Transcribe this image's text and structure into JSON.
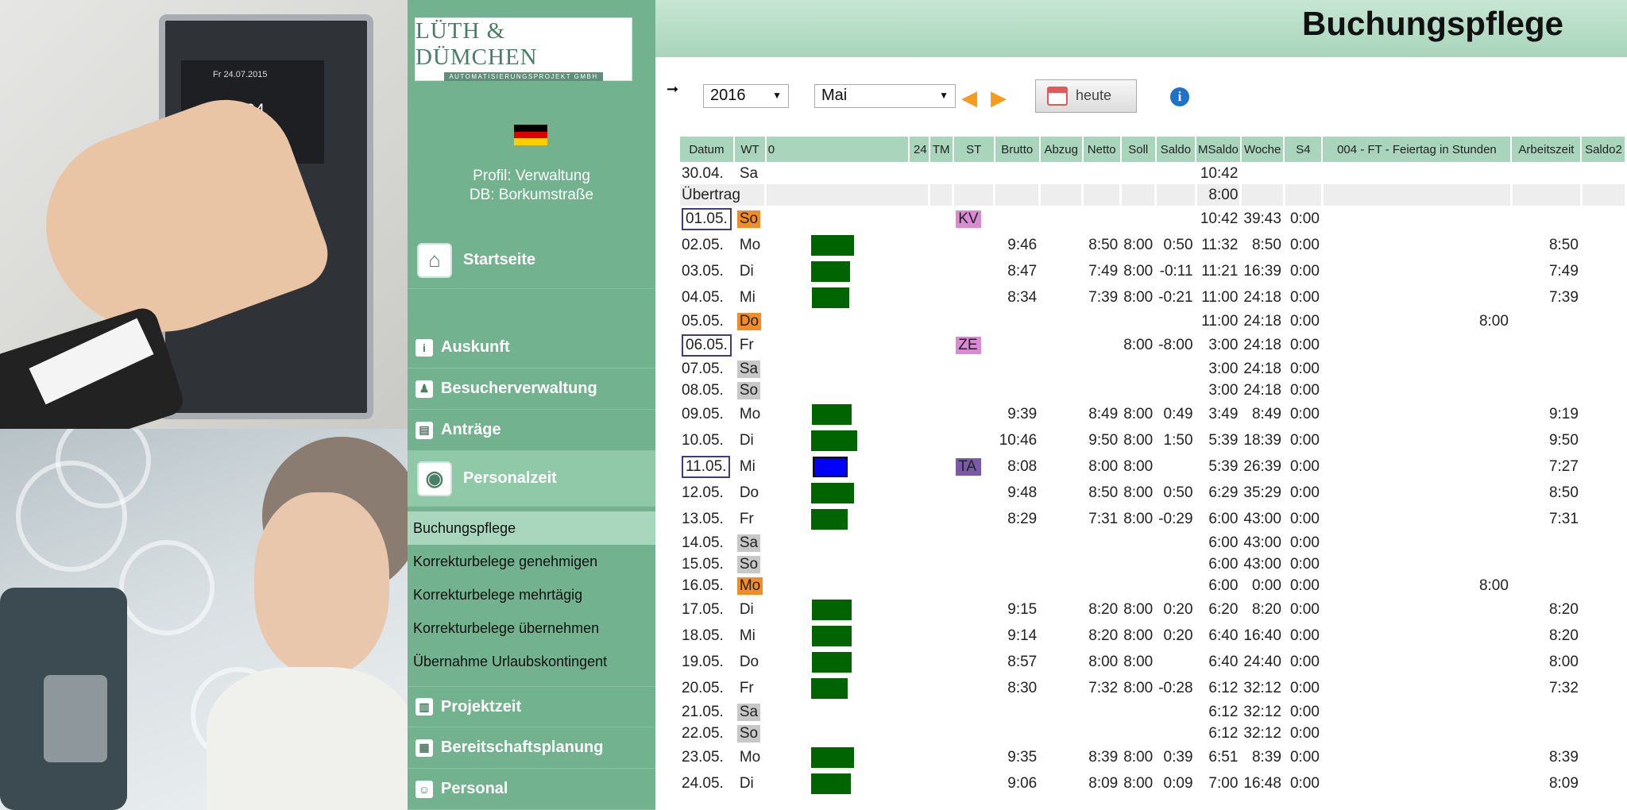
{
  "sidebar": {
    "logo_main": "LÜTH & DÜMCHEN",
    "logo_sub": "AUTOMATISIERUNGSPROJEKT GMBH",
    "profile_line1": "Profil: Verwaltung",
    "profile_line2": "DB: Borkumstraße",
    "startseite": "Startseite",
    "auskunft": "Auskunft",
    "besucherverwaltung": "Besucherverwaltung",
    "antraege": "Anträge",
    "personalzeit": "Personalzeit",
    "subitems": [
      "Buchungspflege",
      "Korrekturbelege genehmigen",
      "Korrekturbelege mehrtägig",
      "Korrekturbelege übernehmen",
      "Übernahme Urlaubskontingent"
    ],
    "projektzeit": "Projektzeit",
    "bereitschaftsplanung": "Bereitschaftsplanung",
    "personal": "Personal"
  },
  "terminal_screen": {
    "date": "Fr 24.07.2015",
    "time": "08:24"
  },
  "page": {
    "title": "Buchungspflege"
  },
  "toolbar": {
    "year": "2016",
    "month": "Mai",
    "today_label": "heute"
  },
  "table": {
    "headers": [
      "Datum",
      "WT",
      "0",
      "24",
      "TM",
      "ST",
      "Brutto",
      "Abzug",
      "Netto",
      "Soll",
      "Saldo",
      "MSaldo",
      "Woche",
      "S4",
      "004 - FT - Feiertag in Stunden",
      "Arbeitszeit",
      "Saldo2"
    ],
    "colors": {
      "green": "#006400",
      "blue": "#0000ff",
      "orange": "#f28c28",
      "gray": "#c8c8c8",
      "pink": "#d98ad3",
      "purple": "#7a5aa8"
    },
    "rows": [
      {
        "datum": "30.04.",
        "wt": "Sa",
        "wt_style": "none",
        "boxed": false,
        "st": "",
        "brutto": "",
        "netto": "",
        "soll": "",
        "saldo": "",
        "msaldo": "10:42",
        "woche": "",
        "s4": "",
        "ft": "",
        "arbeitszeit": "",
        "bar": null,
        "alt": false,
        "tall": false
      },
      {
        "datum": "Übertrag",
        "wt": "",
        "wt_style": "none",
        "boxed": false,
        "st": "",
        "brutto": "",
        "netto": "",
        "soll": "",
        "saldo": "",
        "msaldo": "8:00",
        "woche": "",
        "s4": "",
        "ft": "",
        "arbeitszeit": "",
        "bar": null,
        "alt": true,
        "tall": false
      },
      {
        "datum": "01.05.",
        "wt": "So",
        "wt_style": "orange",
        "boxed": true,
        "st": "KV",
        "st_color": "pink",
        "brutto": "",
        "netto": "",
        "soll": "",
        "saldo": "",
        "msaldo": "10:42",
        "woche": "39:43",
        "s4": "0:00",
        "ft": "",
        "arbeitszeit": "",
        "bar": null,
        "alt": false,
        "tall": true
      },
      {
        "datum": "02.05.",
        "wt": "Mo",
        "wt_style": "none",
        "boxed": false,
        "st": "",
        "brutto": "9:46",
        "netto": "8:50",
        "soll": "8:00",
        "saldo": "0:50",
        "msaldo": "11:32",
        "woche": "8:50",
        "s4": "0:00",
        "ft": "",
        "arbeitszeit": "8:50",
        "bar": {
          "start_hour": 6.4,
          "end_hour": 12.8,
          "color": "green"
        },
        "alt": false,
        "tall": true
      },
      {
        "datum": "03.05.",
        "wt": "Di",
        "wt_style": "none",
        "boxed": false,
        "st": "",
        "brutto": "8:47",
        "netto": "7:49",
        "soll": "8:00",
        "saldo": "-0:11",
        "msaldo": "11:21",
        "woche": "16:39",
        "s4": "0:00",
        "ft": "",
        "arbeitszeit": "7:49",
        "bar": {
          "start_hour": 6.4,
          "end_hour": 12.2,
          "color": "green"
        },
        "alt": false,
        "tall": true
      },
      {
        "datum": "04.05.",
        "wt": "Mi",
        "wt_style": "none",
        "boxed": false,
        "st": "",
        "brutto": "8:34",
        "netto": "7:39",
        "soll": "8:00",
        "saldo": "-0:21",
        "msaldo": "11:00",
        "woche": "24:18",
        "s4": "0:00",
        "ft": "",
        "arbeitszeit": "7:39",
        "bar": {
          "start_hour": 6.5,
          "end_hour": 12.1,
          "color": "green"
        },
        "alt": false,
        "tall": true
      },
      {
        "datum": "05.05.",
        "wt": "Do",
        "wt_style": "orange",
        "boxed": false,
        "st": "",
        "brutto": "",
        "netto": "",
        "soll": "",
        "saldo": "",
        "msaldo": "11:00",
        "woche": "24:18",
        "s4": "0:00",
        "ft": "8:00",
        "arbeitszeit": "",
        "bar": null,
        "alt": false,
        "tall": false
      },
      {
        "datum": "06.05.",
        "wt": "Fr",
        "wt_style": "none",
        "boxed": true,
        "st": "ZE",
        "st_color": "pink",
        "brutto": "",
        "netto": "",
        "soll": "8:00",
        "saldo": "-8:00",
        "msaldo": "3:00",
        "woche": "24:18",
        "s4": "0:00",
        "ft": "",
        "arbeitszeit": "",
        "bar": null,
        "alt": false,
        "tall": true
      },
      {
        "datum": "07.05.",
        "wt": "Sa",
        "wt_style": "gray",
        "boxed": false,
        "st": "",
        "brutto": "",
        "netto": "",
        "soll": "",
        "saldo": "",
        "msaldo": "3:00",
        "woche": "24:18",
        "s4": "0:00",
        "ft": "",
        "arbeitszeit": "",
        "bar": null,
        "alt": false,
        "tall": false
      },
      {
        "datum": "08.05.",
        "wt": "So",
        "wt_style": "gray",
        "boxed": false,
        "st": "",
        "brutto": "",
        "netto": "",
        "soll": "",
        "saldo": "",
        "msaldo": "3:00",
        "woche": "24:18",
        "s4": "0:00",
        "ft": "",
        "arbeitszeit": "",
        "bar": null,
        "alt": false,
        "tall": false
      },
      {
        "datum": "09.05.",
        "wt": "Mo",
        "wt_style": "none",
        "boxed": false,
        "st": "",
        "brutto": "9:39",
        "netto": "8:49",
        "soll": "8:00",
        "saldo": "0:49",
        "msaldo": "3:49",
        "woche": "8:49",
        "s4": "0:00",
        "ft": "",
        "arbeitszeit": "9:19",
        "bar": {
          "start_hour": 6.5,
          "end_hour": 12.4,
          "color": "green"
        },
        "alt": false,
        "tall": true
      },
      {
        "datum": "10.05.",
        "wt": "Di",
        "wt_style": "none",
        "boxed": false,
        "st": "",
        "brutto": "10:46",
        "netto": "9:50",
        "soll": "8:00",
        "saldo": "1:50",
        "msaldo": "5:39",
        "woche": "18:39",
        "s4": "0:00",
        "ft": "",
        "arbeitszeit": "9:50",
        "bar": {
          "start_hour": 6.4,
          "end_hour": 13.3,
          "color": "green"
        },
        "alt": false,
        "tall": true
      },
      {
        "datum": "11.05.",
        "wt": "Mi",
        "wt_style": "none",
        "boxed": true,
        "st": "TA",
        "st_color": "purple",
        "brutto": "8:08",
        "netto": "8:00",
        "soll": "8:00",
        "saldo": "",
        "msaldo": "5:39",
        "woche": "26:39",
        "s4": "0:00",
        "ft": "",
        "arbeitszeit": "7:27",
        "bar": {
          "start_hour": 6.6,
          "end_hour": 11.8,
          "color": "blue"
        },
        "alt": false,
        "tall": true
      },
      {
        "datum": "12.05.",
        "wt": "Do",
        "wt_style": "none",
        "boxed": false,
        "st": "",
        "brutto": "9:48",
        "netto": "8:50",
        "soll": "8:00",
        "saldo": "0:50",
        "msaldo": "6:29",
        "woche": "35:29",
        "s4": "0:00",
        "ft": "",
        "arbeitszeit": "8:50",
        "bar": {
          "start_hour": 6.4,
          "end_hour": 12.8,
          "color": "green"
        },
        "alt": false,
        "tall": true
      },
      {
        "datum": "13.05.",
        "wt": "Fr",
        "wt_style": "none",
        "boxed": false,
        "st": "",
        "brutto": "8:29",
        "netto": "7:31",
        "soll": "8:00",
        "saldo": "-0:29",
        "msaldo": "6:00",
        "woche": "43:00",
        "s4": "0:00",
        "ft": "",
        "arbeitszeit": "7:31",
        "bar": {
          "start_hour": 6.4,
          "end_hour": 11.9,
          "color": "green"
        },
        "alt": false,
        "tall": true
      },
      {
        "datum": "14.05.",
        "wt": "Sa",
        "wt_style": "gray",
        "boxed": false,
        "st": "",
        "brutto": "",
        "netto": "",
        "soll": "",
        "saldo": "",
        "msaldo": "6:00",
        "woche": "43:00",
        "s4": "0:00",
        "ft": "",
        "arbeitszeit": "",
        "bar": null,
        "alt": false,
        "tall": false
      },
      {
        "datum": "15.05.",
        "wt": "So",
        "wt_style": "gray",
        "boxed": false,
        "st": "",
        "brutto": "",
        "netto": "",
        "soll": "",
        "saldo": "",
        "msaldo": "6:00",
        "woche": "43:00",
        "s4": "0:00",
        "ft": "",
        "arbeitszeit": "",
        "bar": null,
        "alt": false,
        "tall": false
      },
      {
        "datum": "16.05.",
        "wt": "Mo",
        "wt_style": "orange",
        "boxed": false,
        "st": "",
        "brutto": "",
        "netto": "",
        "soll": "",
        "saldo": "",
        "msaldo": "6:00",
        "woche": "0:00",
        "s4": "0:00",
        "ft": "8:00",
        "arbeitszeit": "",
        "bar": null,
        "alt": false,
        "tall": false
      },
      {
        "datum": "17.05.",
        "wt": "Di",
        "wt_style": "none",
        "boxed": false,
        "st": "",
        "brutto": "9:15",
        "netto": "8:20",
        "soll": "8:00",
        "saldo": "0:20",
        "msaldo": "6:20",
        "woche": "8:20",
        "s4": "0:00",
        "ft": "",
        "arbeitszeit": "8:20",
        "bar": {
          "start_hour": 6.5,
          "end_hour": 12.5,
          "color": "green"
        },
        "alt": false,
        "tall": true
      },
      {
        "datum": "18.05.",
        "wt": "Mi",
        "wt_style": "none",
        "boxed": false,
        "st": "",
        "brutto": "9:14",
        "netto": "8:20",
        "soll": "8:00",
        "saldo": "0:20",
        "msaldo": "6:40",
        "woche": "16:40",
        "s4": "0:00",
        "ft": "",
        "arbeitszeit": "8:20",
        "bar": {
          "start_hour": 6.5,
          "end_hour": 12.5,
          "color": "green"
        },
        "alt": false,
        "tall": true
      },
      {
        "datum": "19.05.",
        "wt": "Do",
        "wt_style": "none",
        "boxed": false,
        "st": "",
        "brutto": "8:57",
        "netto": "8:00",
        "soll": "8:00",
        "saldo": "",
        "msaldo": "6:40",
        "woche": "24:40",
        "s4": "0:00",
        "ft": "",
        "arbeitszeit": "8:00",
        "bar": {
          "start_hour": 6.5,
          "end_hour": 12.4,
          "color": "green"
        },
        "alt": false,
        "tall": true
      },
      {
        "datum": "20.05.",
        "wt": "Fr",
        "wt_style": "none",
        "boxed": false,
        "st": "",
        "brutto": "8:30",
        "netto": "7:32",
        "soll": "8:00",
        "saldo": "-0:28",
        "msaldo": "6:12",
        "woche": "32:12",
        "s4": "0:00",
        "ft": "",
        "arbeitszeit": "7:32",
        "bar": {
          "start_hour": 6.4,
          "end_hour": 11.9,
          "color": "green"
        },
        "alt": false,
        "tall": true
      },
      {
        "datum": "21.05.",
        "wt": "Sa",
        "wt_style": "gray",
        "boxed": false,
        "st": "",
        "brutto": "",
        "netto": "",
        "soll": "",
        "saldo": "",
        "msaldo": "6:12",
        "woche": "32:12",
        "s4": "0:00",
        "ft": "",
        "arbeitszeit": "",
        "bar": null,
        "alt": false,
        "tall": false
      },
      {
        "datum": "22.05.",
        "wt": "So",
        "wt_style": "gray",
        "boxed": false,
        "st": "",
        "brutto": "",
        "netto": "",
        "soll": "",
        "saldo": "",
        "msaldo": "6:12",
        "woche": "32:12",
        "s4": "0:00",
        "ft": "",
        "arbeitszeit": "",
        "bar": null,
        "alt": false,
        "tall": false
      },
      {
        "datum": "23.05.",
        "wt": "Mo",
        "wt_style": "none",
        "boxed": false,
        "st": "",
        "brutto": "9:35",
        "netto": "8:39",
        "soll": "8:00",
        "saldo": "0:39",
        "msaldo": "6:51",
        "woche": "8:39",
        "s4": "0:00",
        "ft": "",
        "arbeitszeit": "8:39",
        "bar": {
          "start_hour": 6.4,
          "end_hour": 12.8,
          "color": "green"
        },
        "alt": false,
        "tall": true
      },
      {
        "datum": "24.05.",
        "wt": "Di",
        "wt_style": "none",
        "boxed": false,
        "st": "",
        "brutto": "9:06",
        "netto": "8:09",
        "soll": "8:00",
        "saldo": "0:09",
        "msaldo": "7:00",
        "woche": "16:48",
        "s4": "0:00",
        "ft": "",
        "arbeitszeit": "8:09",
        "bar": {
          "start_hour": 6.4,
          "end_hour": 12.3,
          "color": "green"
        },
        "alt": false,
        "tall": true
      }
    ]
  }
}
